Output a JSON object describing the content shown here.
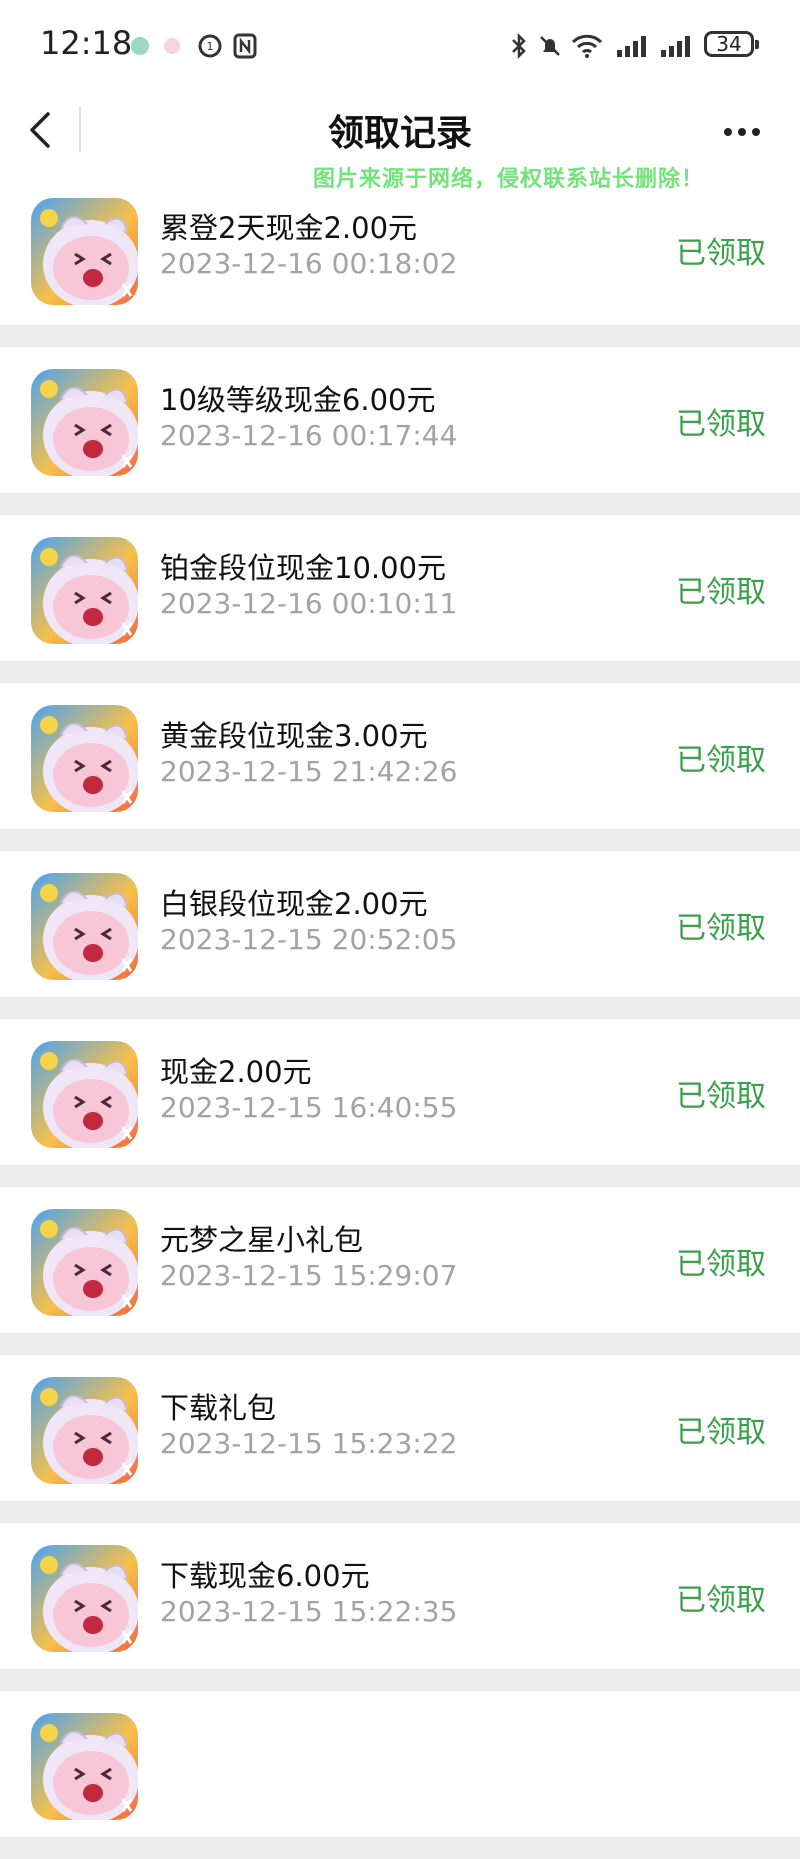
{
  "status_bar": {
    "time": "12:18",
    "battery": "34",
    "left_icons": [
      "chat-bubble-icon",
      "pig-icon",
      "data-saver-icon",
      "nfc-icon"
    ],
    "right_icons": [
      "bluetooth-icon",
      "mute-bell-icon",
      "wifi-icon",
      "signal-icon",
      "signal-icon"
    ]
  },
  "header": {
    "title": "领取记录",
    "back_icon": "chevron-left-icon",
    "more_icon": "more-dots-icon"
  },
  "watermark": "图片来源于网络，侵权联系站长删除！",
  "colors": {
    "claimed": "#3aa04a",
    "date": "#a3a3a3",
    "divider": "#ededed"
  },
  "records": [
    {
      "name": "累登2天现金2.00元",
      "date": "2023-12-16 00:18:02",
      "status": "已领取"
    },
    {
      "name": "10级等级现金6.00元",
      "date": "2023-12-16 00:17:44",
      "status": "已领取"
    },
    {
      "name": "铂金段位现金10.00元",
      "date": "2023-12-16 00:10:11",
      "status": "已领取"
    },
    {
      "name": "黄金段位现金3.00元",
      "date": "2023-12-15 21:42:26",
      "status": "已领取"
    },
    {
      "name": "白银段位现金2.00元",
      "date": "2023-12-15 20:52:05",
      "status": "已领取"
    },
    {
      "name": "现金2.00元",
      "date": "2023-12-15 16:40:55",
      "status": "已领取"
    },
    {
      "name": "元梦之星小礼包",
      "date": "2023-12-15 15:29:07",
      "status": "已领取"
    },
    {
      "name": "下载礼包",
      "date": "2023-12-15 15:23:22",
      "status": "已领取"
    },
    {
      "name": "下载现金6.00元",
      "date": "2023-12-15 15:22:35",
      "status": "已领取"
    },
    {
      "name": "",
      "date": "",
      "status": ""
    }
  ]
}
